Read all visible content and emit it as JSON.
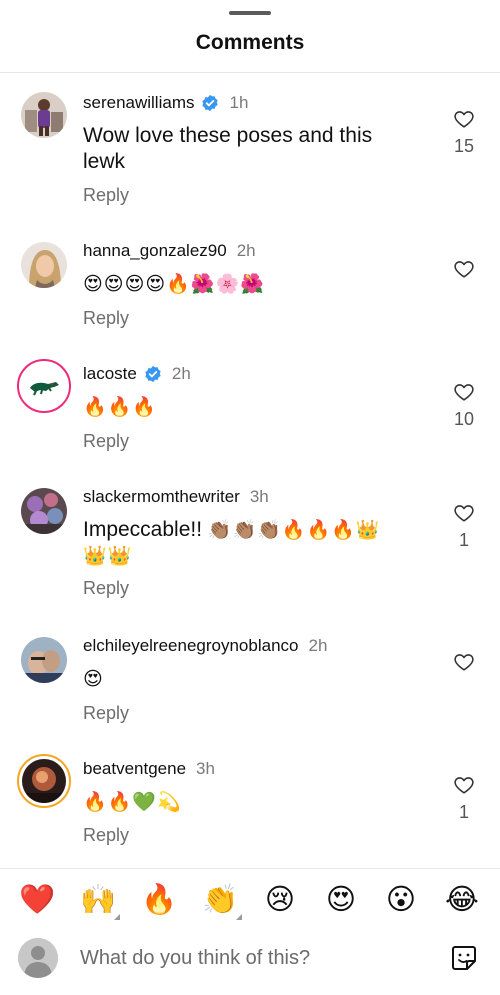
{
  "header": {
    "title": "Comments"
  },
  "comments": [
    {
      "username": "serenawilliams",
      "verified": true,
      "time": "1h",
      "text": "Wow love these poses and this lewk",
      "emojis": "",
      "reply": "Reply",
      "likes": "15"
    },
    {
      "username": "hanna_gonzalez90",
      "verified": false,
      "time": "2h",
      "text": "",
      "emojis": "😍😍😍😍🔥🌺🌸🌺",
      "reply": "Reply",
      "likes": ""
    },
    {
      "username": "lacoste",
      "verified": true,
      "time": "2h",
      "text": "",
      "emojis": "🔥🔥🔥",
      "reply": "Reply",
      "likes": "10"
    },
    {
      "username": "slackermomthewriter",
      "verified": false,
      "time": "3h",
      "text": "Impeccable!!",
      "emojis": "👏🏽👏🏽👏🏽🔥🔥🔥👑",
      "emojis2": "👑👑",
      "reply": "Reply",
      "likes": "1"
    },
    {
      "username": "elchileyelreenegroynoblanco",
      "verified": false,
      "time": "2h",
      "text": "",
      "emojis": "😍",
      "reply": "Reply",
      "likes": ""
    },
    {
      "username": "beatventgene",
      "verified": false,
      "time": "3h",
      "text": "",
      "emojis": "🔥🔥💚💫",
      "reply": "Reply",
      "likes": "1"
    }
  ],
  "reactions": [
    "❤️",
    "🙌",
    "🔥",
    "👏",
    "😢",
    "😍",
    "😮",
    "😂"
  ],
  "composer": {
    "placeholder": "What do you think of this?"
  },
  "colors": {
    "accent_blue": "#3897f0",
    "ring_gradient": [
      "#f9ce34",
      "#ee2a7b",
      "#6228d7"
    ]
  },
  "icons": {
    "like": "heart-outline-icon",
    "verified": "verified-badge-icon",
    "sticker": "sticker-icon",
    "avatar_placeholder": "person-icon"
  }
}
